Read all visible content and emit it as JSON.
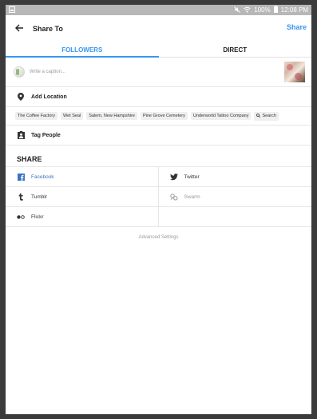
{
  "status_bar": {
    "battery_percent": "100%",
    "time": "12:08 PM"
  },
  "header": {
    "title": "Share To",
    "share_label": "Share"
  },
  "tabs": [
    {
      "label": "FOLLOWERS",
      "active": true
    },
    {
      "label": "DIRECT",
      "active": false
    }
  ],
  "caption": {
    "placeholder": "Write a caption..."
  },
  "location": {
    "label": "Add Location",
    "suggestions": [
      "The Coffee Factory",
      "Wet Seal",
      "Salem, New Hampshire",
      "Pine Grove Cemetery",
      "Underworld Tattoo Company"
    ],
    "search_label": "Search"
  },
  "tag_people": {
    "label": "Tag People"
  },
  "share": {
    "header": "SHARE",
    "services": [
      {
        "name": "Facebook",
        "icon": "facebook-icon",
        "active": true,
        "color": "#3b74c7"
      },
      {
        "name": "Twitter",
        "icon": "twitter-icon",
        "active": false,
        "color": "#333333"
      },
      {
        "name": "Tumblr",
        "icon": "tumblr-icon",
        "active": false,
        "color": "#333333"
      },
      {
        "name": "Swarm",
        "icon": "swarm-icon",
        "active": false,
        "color": "#999999"
      },
      {
        "name": "Flickr",
        "icon": "flickr-icon",
        "active": false,
        "color": "#333333"
      }
    ]
  },
  "advanced_settings": {
    "label": "Advanced Settings"
  },
  "colors": {
    "accent": "#3897f0",
    "status_bar": "#b7b7b7",
    "facebook": "#3b74c7"
  }
}
